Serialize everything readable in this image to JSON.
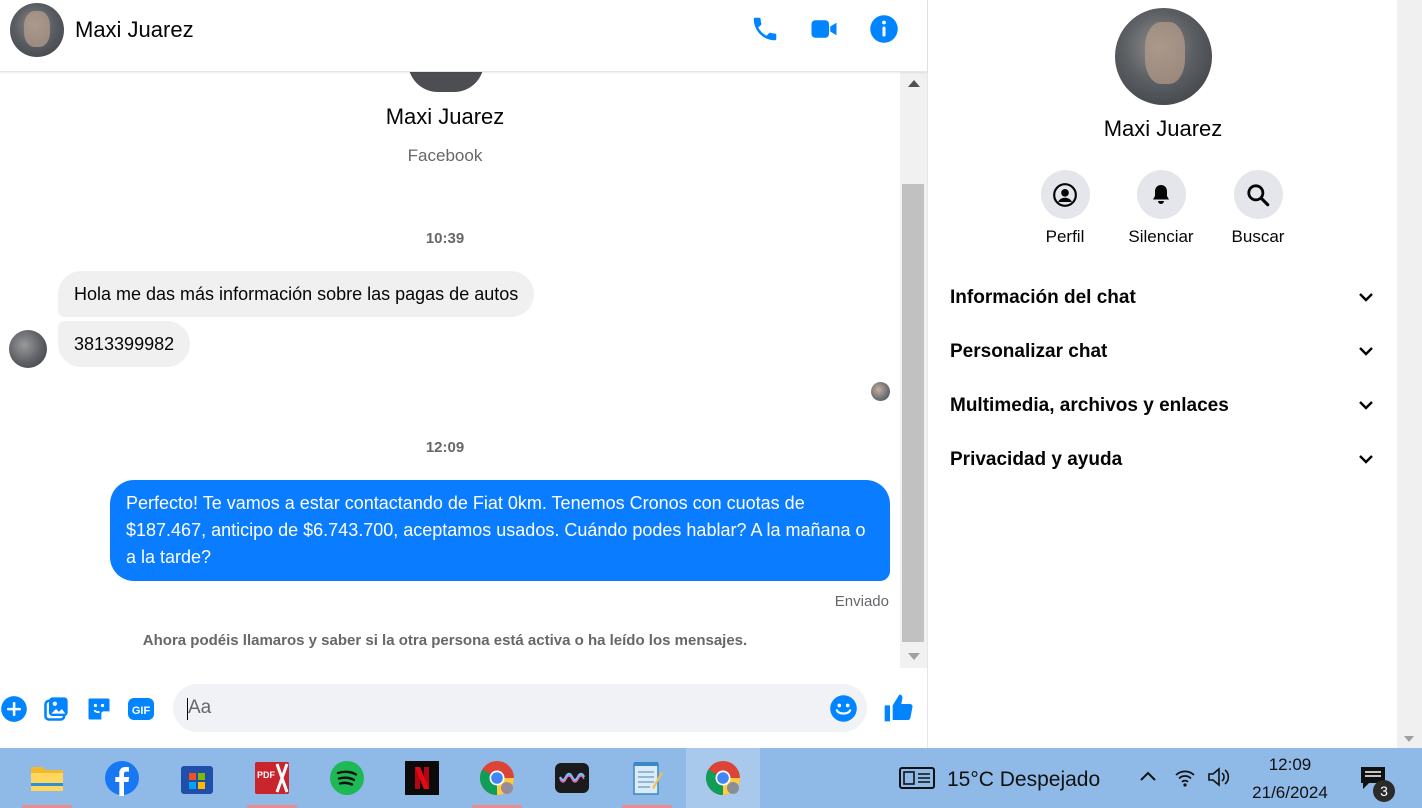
{
  "contact": {
    "name": "Maxi Juarez",
    "source": "Facebook"
  },
  "header": {
    "name": "Maxi Juarez",
    "icons": [
      "phone-icon",
      "video-icon",
      "info-icon"
    ]
  },
  "thread": {
    "time1": "10:39",
    "incoming": [
      "Hola me das más información sobre las pagas de autos",
      "3813399982"
    ],
    "time2": "12:09",
    "outgoing": "Perfecto! Te vamos a estar contactando de Fiat 0km. Tenemos Cronos con cuotas de $187.467, anticipo de $6.743.700, aceptamos usados. Cuándo podes hablar? A la mañana o a la tarde?",
    "status": "Enviado",
    "note": "Ahora podéis llamaros y saber si la otra persona está activa o ha leído los mensajes."
  },
  "composer": {
    "placeholder": "Aa",
    "gif_label": "GIF"
  },
  "side": {
    "name": "Maxi Juarez",
    "actions": [
      {
        "label": "Perfil",
        "icon": "profile-icon"
      },
      {
        "label": "Silenciar",
        "icon": "bell-icon"
      },
      {
        "label": "Buscar",
        "icon": "search-icon"
      }
    ],
    "sections": [
      "Información del chat",
      "Personalizar chat",
      "Multimedia, archivos y enlaces",
      "Privacidad y ayuda"
    ]
  },
  "taskbar": {
    "weather": "15°C  Despejado",
    "time": "12:09",
    "date": "21/6/2024",
    "notifications": "3",
    "apps": [
      "file-explorer",
      "facebook",
      "microsoft-store",
      "pdf-x",
      "spotify",
      "netflix",
      "chrome",
      "winamp",
      "notepad",
      "chrome"
    ]
  },
  "colors": {
    "accent": "#0a7cff",
    "icon_blue": "#0084ff",
    "taskbar": "#8fb9e6"
  }
}
